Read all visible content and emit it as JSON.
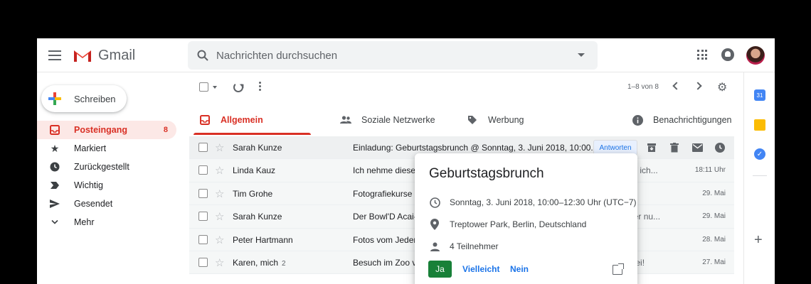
{
  "header": {
    "app_name": "Gmail",
    "search_placeholder": "Nachrichten durchsuchen"
  },
  "sidebar": {
    "compose_label": "Schreiben",
    "items": [
      {
        "label": "Posteingang",
        "count": "8",
        "icon": "inbox-icon"
      },
      {
        "label": "Markiert",
        "count": "",
        "icon": "star-icon"
      },
      {
        "label": "Zurückgestellt",
        "count": "",
        "icon": "clock-icon"
      },
      {
        "label": "Wichtig",
        "count": "",
        "icon": "important-icon"
      },
      {
        "label": "Gesendet",
        "count": "",
        "icon": "send-icon"
      },
      {
        "label": "Mehr",
        "count": "",
        "icon": "chevron-down-icon"
      }
    ]
  },
  "toolbar": {
    "page_info": "1–8 von 8"
  },
  "tabs": [
    {
      "label": "Allgemein",
      "icon": "inbox-icon"
    },
    {
      "label": "Soziale Netzwerke",
      "icon": "people-icon"
    },
    {
      "label": "Werbung",
      "icon": "tag-icon"
    },
    {
      "label": "Benachrichtigungen",
      "icon": "info-icon"
    }
  ],
  "emails": [
    {
      "sender": "Sarah Kunze",
      "count": "",
      "subject": "Einladung: Geburtstagsbrunch @ Sonntag, 3. Juni 2018, 10:00...",
      "tail": "",
      "date": ""
    },
    {
      "sender": "Linda Kauz",
      "count": "",
      "subject": "Ich nehme dieses",
      "tail": "könnte ich...",
      "date": "18:11 Uhr"
    },
    {
      "sender": "Tim Grohe",
      "count": "",
      "subject": "Fotografiekurse -",
      "tail": "",
      "date": "29. Mai"
    },
    {
      "sender": "Sarah Kunze",
      "count": "",
      "subject": "Der Bowl'D Acai-B",
      "tail": "darüber nu...",
      "date": "29. Mai"
    },
    {
      "sender": "Peter Hartmann",
      "count": "",
      "subject": "Fotos vom Jeder",
      "tail": "",
      "date": "28. Mai"
    },
    {
      "sender": "Karen, mich",
      "count": "2",
      "subject": "Besuch im Zoo v",
      "tail": "e vorbei!",
      "date": "27. Mai"
    }
  ],
  "row_action": {
    "rsvp_label": "Antworten"
  },
  "popup": {
    "title": "Geburtstagsbrunch",
    "datetime": "Sonntag, 3. Juni 2018, 10:00–12:30 Uhr (UTC−7)",
    "location": "Treptower Park, Berlin, Deutschland",
    "guests": "4 Teilnehmer",
    "yes": "Ja",
    "maybe": "Vielleicht",
    "no": "Nein"
  },
  "right_panel": {
    "calendar_day": "31"
  },
  "colors": {
    "accent_red": "#d93025",
    "link_blue": "#1a73e8",
    "yes_green": "#188038"
  }
}
